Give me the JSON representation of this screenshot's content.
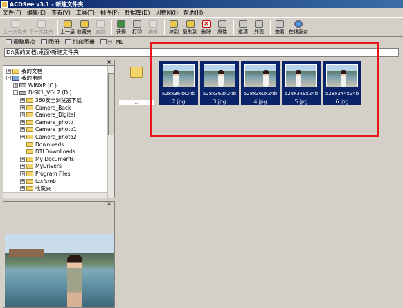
{
  "window": {
    "title": "ACDSee v3.1 - 新建文件夹"
  },
  "menu": [
    "文件(F)",
    "编辑(E)",
    "查看(V)",
    "工具(T)",
    "插件(P)",
    "数据库(D)",
    "因特网(I)",
    "帮助(H)"
  ],
  "toolbar": {
    "buttons": [
      {
        "label": "上一文件夹",
        "disabled": true,
        "icon": "prev-folder-icon"
      },
      {
        "label": "下一文件夹",
        "disabled": true,
        "icon": "next-folder-icon"
      },
      {
        "label": "上一层",
        "disabled": false,
        "icon": "up-level-icon"
      },
      {
        "label": "收藏夹",
        "disabled": false,
        "icon": "favorites-icon"
      },
      {
        "label": "查找",
        "disabled": true,
        "icon": "find-icon"
      },
      {
        "label": "获得",
        "disabled": false,
        "icon": "acquire-icon"
      },
      {
        "label": "打印",
        "disabled": false,
        "icon": "print-icon"
      },
      {
        "label": "编辑",
        "disabled": true,
        "icon": "edit-icon"
      },
      {
        "label": "移到",
        "disabled": false,
        "icon": "move-to-icon"
      },
      {
        "label": "复制到",
        "disabled": false,
        "icon": "copy-to-icon"
      },
      {
        "label": "删除",
        "disabled": false,
        "icon": "delete-icon"
      },
      {
        "label": "属性",
        "disabled": false,
        "icon": "properties-icon"
      },
      {
        "label": "选项",
        "disabled": false,
        "icon": "options-icon"
      },
      {
        "label": "外观",
        "disabled": false,
        "icon": "appearance-icon"
      },
      {
        "label": "查看",
        "disabled": false,
        "icon": "view-icon"
      },
      {
        "label": "在线服务",
        "disabled": false,
        "icon": "online-service-icon"
      }
    ]
  },
  "toolbar2": [
    "调整层次",
    "图册",
    "打印图册",
    "HTML"
  ],
  "path": "D:\\我的文档\\桌面\\新建文件夹",
  "tree": [
    {
      "label": "我的文档",
      "level": 0,
      "kind": "folder",
      "expander": "+"
    },
    {
      "label": "我的电脑",
      "level": 0,
      "kind": "pc",
      "expander": "-"
    },
    {
      "label": "WINXP (C:)",
      "level": 1,
      "kind": "drive",
      "expander": "+"
    },
    {
      "label": "DISK1_VOL2 (D:)",
      "level": 1,
      "kind": "drive",
      "expander": "-"
    },
    {
      "label": "360安全浏览器下载",
      "level": 2,
      "kind": "folder",
      "expander": "+"
    },
    {
      "label": "Camera_Back",
      "level": 2,
      "kind": "folder",
      "expander": "+"
    },
    {
      "label": "Camera_Digital",
      "level": 2,
      "kind": "folder",
      "expander": "+"
    },
    {
      "label": "Camera_photo",
      "level": 2,
      "kind": "folder",
      "expander": "+"
    },
    {
      "label": "Camera_photo1",
      "level": 2,
      "kind": "folder",
      "expander": "+"
    },
    {
      "label": "Camera_photo2",
      "level": 2,
      "kind": "folder",
      "expander": "+"
    },
    {
      "label": "Downloads",
      "level": 2,
      "kind": "folder",
      "expander": ""
    },
    {
      "label": "DTLDownLoads",
      "level": 2,
      "kind": "folder",
      "expander": ""
    },
    {
      "label": "My Documents",
      "level": 2,
      "kind": "folder",
      "expander": "+"
    },
    {
      "label": "MyDrivers",
      "level": 2,
      "kind": "folder",
      "expander": "+"
    },
    {
      "label": "Program Files",
      "level": 2,
      "kind": "folder",
      "expander": "+"
    },
    {
      "label": "tzxfsmb",
      "level": 2,
      "kind": "folder",
      "expander": "+"
    },
    {
      "label": "收藏夹",
      "level": 2,
      "kind": "folder",
      "expander": "+"
    }
  ],
  "files": {
    "updir_label": "..",
    "items": [
      {
        "name": "2.jpg",
        "dims": "528x364x24b"
      },
      {
        "name": "3.jpg",
        "dims": "528x362x24b"
      },
      {
        "name": "4.jpg",
        "dims": "528x360x24b"
      },
      {
        "name": "5.jpg",
        "dims": "528x349x24b"
      },
      {
        "name": "6.jpg",
        "dims": "528x344x24b"
      }
    ]
  },
  "colors": {
    "selection": "#0a246a",
    "highlight_box": "#e8161a",
    "face": "#d4d0c8"
  }
}
